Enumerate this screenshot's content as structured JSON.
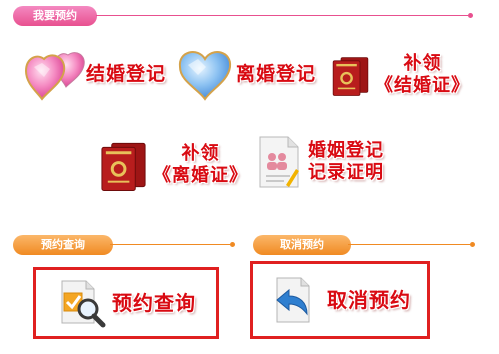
{
  "sections": {
    "reserve": {
      "title": "我要预约"
    },
    "query": {
      "title": "预约查询"
    },
    "cancel": {
      "title": "取消预约"
    }
  },
  "services": {
    "marriage_reg": {
      "label": "结婚登记",
      "icon": "pink-heart-icon"
    },
    "divorce_reg": {
      "label": "离婚登记",
      "icon": "blue-heart-icon"
    },
    "reissue_marriage": {
      "line1": "补领",
      "line2": "《结婚证》",
      "icon": "red-certificate-icon"
    },
    "reissue_divorce": {
      "line1": "补领",
      "line2": "《离婚证》",
      "icon": "red-certificate-icon"
    },
    "record_proof": {
      "line1": "婚姻登记",
      "line2": "记录证明",
      "icon": "document-people-icon"
    }
  },
  "actions": {
    "query": {
      "label": "预约查询",
      "icon": "magnifier-document-icon"
    },
    "cancel": {
      "label": "取消预约",
      "icon": "undo-document-icon"
    }
  },
  "colors": {
    "pink": "#e8508f",
    "orange": "#f08a22",
    "red": "#d90a12",
    "box_border": "#e02020"
  }
}
